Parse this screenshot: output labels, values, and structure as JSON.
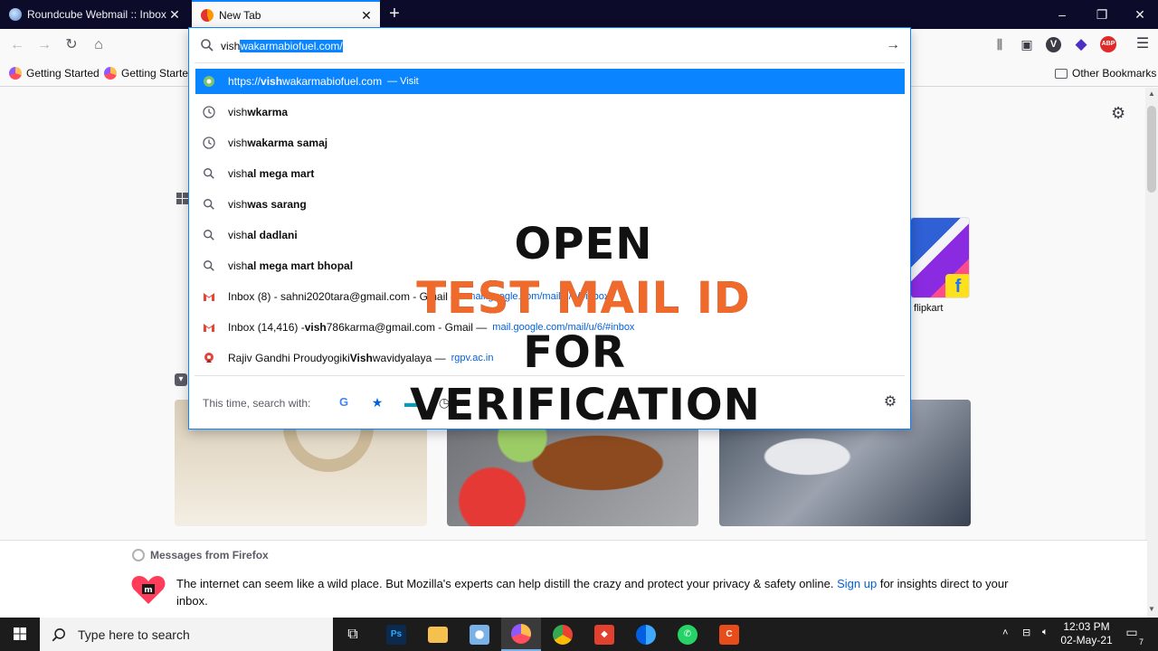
{
  "window": {
    "tabs": [
      {
        "label": "Roundcube Webmail :: Inbox",
        "active": false
      },
      {
        "label": "New Tab",
        "active": true
      }
    ],
    "new_tab_icon": "plus-icon",
    "controls": {
      "minimize": "–",
      "maximize": "❐",
      "close": "✕"
    }
  },
  "bookmarks": {
    "items": [
      "Getting Started",
      "Getting Started"
    ],
    "other": "Other Bookmarks"
  },
  "urlbar": {
    "typed": "vish",
    "autofill": "wakarmabiofuel.com/",
    "suggestions": [
      {
        "icon": "globe-icon",
        "prefix": "https://",
        "typed": "vish",
        "rest": "wakarmabiofuel.com",
        "action": "— Visit",
        "url": "",
        "selected": true
      },
      {
        "icon": "history-icon",
        "prefix": "",
        "typed": "vish",
        "rest": "wkarma",
        "action": "",
        "url": "",
        "selected": false
      },
      {
        "icon": "history-icon",
        "prefix": "",
        "typed": "vish",
        "rest": "wakarma samaj",
        "action": "",
        "url": "",
        "selected": false
      },
      {
        "icon": "search-icon",
        "prefix": "",
        "typed": "vish",
        "rest": "al mega mart",
        "action": "",
        "url": "",
        "selected": false
      },
      {
        "icon": "search-icon",
        "prefix": "",
        "typed": "vish",
        "rest": "was sarang",
        "action": "",
        "url": "",
        "selected": false
      },
      {
        "icon": "search-icon",
        "prefix": "",
        "typed": "vish",
        "rest": "al dadlani",
        "action": "",
        "url": "",
        "selected": false
      },
      {
        "icon": "search-icon",
        "prefix": "",
        "typed": "vish",
        "rest": "al mega mart bhopal",
        "action": "",
        "url": "",
        "selected": false
      },
      {
        "icon": "gmail-icon",
        "text_before": "Inbox (8) - sahni2020tara@gmail.com - Gmail —",
        "url": "mail.google.com/mail/u/1/#inbox",
        "selected": false
      },
      {
        "icon": "gmail-icon",
        "text_before": "Inbox (14,416) - ",
        "bold": "vish",
        "text_after": "786karma@gmail.com - Gmail —",
        "url": "mail.google.com/mail/u/6/#inbox",
        "selected": false
      },
      {
        "icon": "rgpv-icon",
        "text_before": "Rajiv Gandhi Proudyogiki ",
        "bold": "Vish",
        "text_after": "wavidyalaya —",
        "url": "rgpv.ac.in",
        "selected": false
      }
    ],
    "oneoff_label": "This time, search with:"
  },
  "content": {
    "topsite_label": "flipkart"
  },
  "overlay": {
    "line1": "OPEN",
    "line2": "TEST MAIL ID",
    "line3": "FOR",
    "line4": "VERIFICATION"
  },
  "messages": {
    "header": "Messages from Firefox",
    "text_before": "The internet can seem like a wild place. But Mozilla's experts can help distill the crazy and protect your privacy & safety online.",
    "link": "Sign up",
    "text_after": "for insights direct to your inbox."
  },
  "taskbar": {
    "search_placeholder": "Type here to search",
    "time": "12:03 PM",
    "date": "02-May-21",
    "notification_count": "7"
  },
  "colors": {
    "accent": "#0a84ff",
    "overlay_orange": "#f06b2b"
  }
}
